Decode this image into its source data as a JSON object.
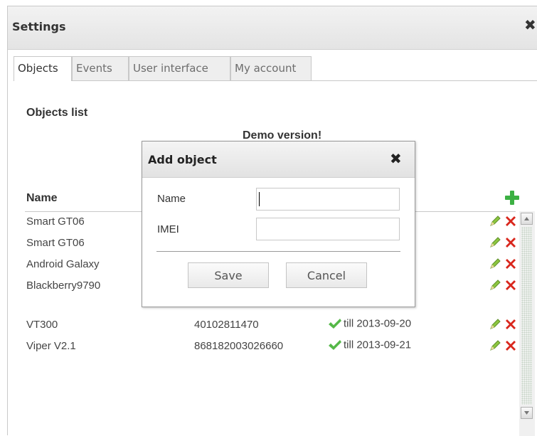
{
  "window": {
    "title": "Settings",
    "close_glyph": "✖"
  },
  "tabs": [
    {
      "label": "Objects",
      "active": true
    },
    {
      "label": "Events",
      "active": false
    },
    {
      "label": "User interface",
      "active": false
    },
    {
      "label": "My account",
      "active": false
    }
  ],
  "objects": {
    "section_title": "Objects list",
    "demo_notice": "Demo version!",
    "column_name": "Name",
    "rows": [
      {
        "name": "Smart GT06",
        "imei": "",
        "status": ""
      },
      {
        "name": "Smart GT06",
        "imei": "",
        "status": ""
      },
      {
        "name": "Android Galaxy",
        "imei": "",
        "status": ""
      },
      {
        "name": "Blackberry9790",
        "imei": "",
        "status": ""
      },
      {
        "name": "VT300",
        "imei": "40102811470",
        "status": "till 2013-09-20"
      },
      {
        "name": "Viper V2.1",
        "imei": "868182003026660",
        "status": "till 2013-09-21"
      }
    ]
  },
  "dialog": {
    "title": "Add object",
    "close_glyph": "✖",
    "name_label": "Name",
    "name_value": "",
    "imei_label": "IMEI",
    "imei_value": "",
    "save_label": "Save",
    "cancel_label": "Cancel"
  },
  "icons": {
    "add": "plus-icon",
    "edit": "pencil-icon",
    "delete": "cross-icon",
    "active": "check-icon"
  },
  "colors": {
    "add_green": "#3cb043",
    "edit_green": "#8cc63f",
    "delete_red": "#d9261c",
    "check_green": "#55b848"
  }
}
